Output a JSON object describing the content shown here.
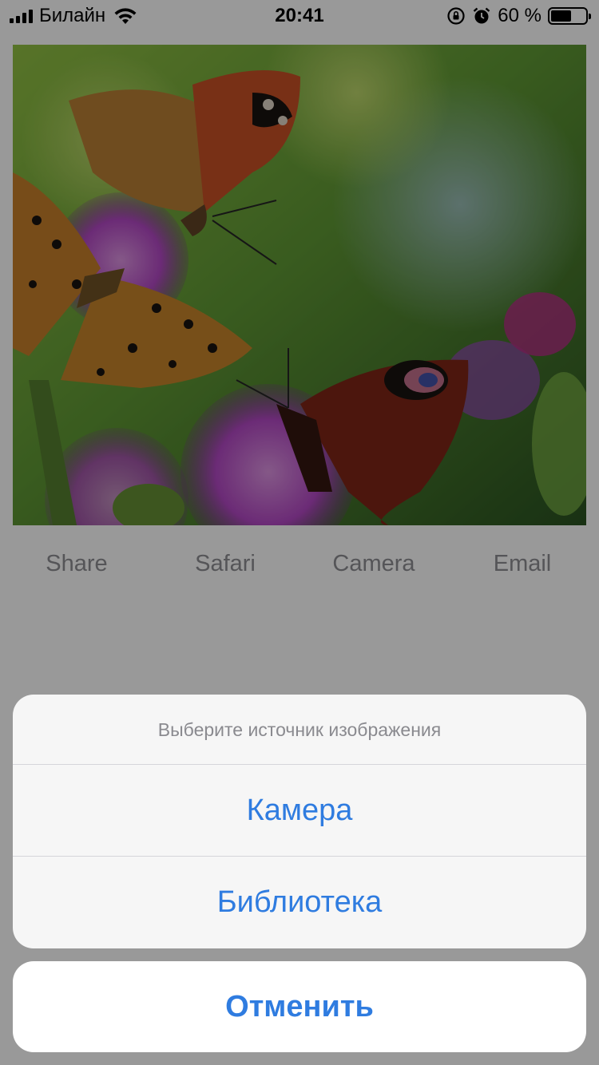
{
  "status_bar": {
    "carrier": "Билайн",
    "time": "20:41",
    "battery_percent": "60 %",
    "battery_level": 0.6,
    "icons": [
      "signal-icon",
      "wifi-icon",
      "rotation-lock-icon",
      "alarm-icon",
      "battery-icon"
    ]
  },
  "photo": {
    "icon": "photo-butterflies"
  },
  "actions": [
    {
      "label": "Share"
    },
    {
      "label": "Safari"
    },
    {
      "label": "Camera"
    },
    {
      "label": "Email"
    }
  ],
  "action_sheet": {
    "title": "Выберите источник изображения",
    "options": [
      {
        "label": "Камера"
      },
      {
        "label": "Библиотека"
      }
    ],
    "cancel_label": "Отменить"
  },
  "colors": {
    "accent": "#2f7ce0",
    "overlay": "rgba(0,0,0,0.40)",
    "muted_text": "#8e8e93"
  }
}
